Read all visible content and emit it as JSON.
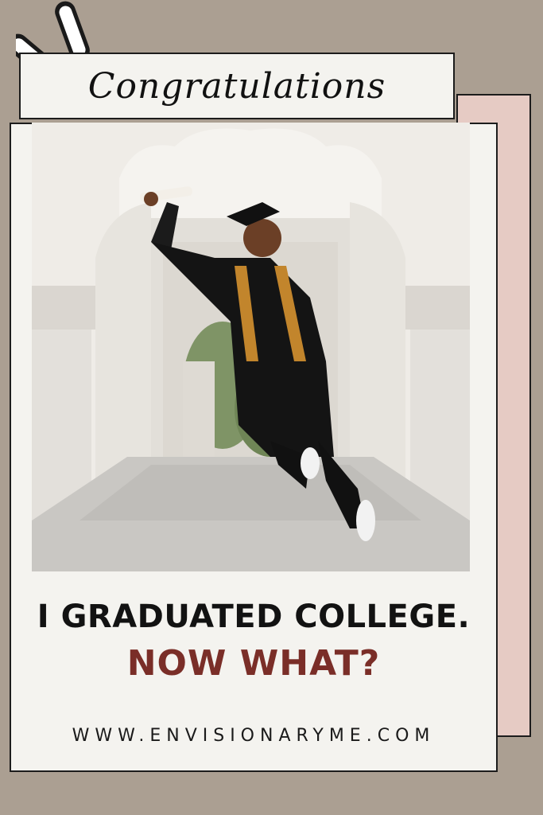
{
  "banner": {
    "text": "Congratulations"
  },
  "headline": {
    "line1": "I GRADUATED COLLEGE.",
    "line2": "NOW WHAT?"
  },
  "footer": {
    "url": "WWW.ENVISIONARYME.COM"
  },
  "colors": {
    "background": "#ab9f92",
    "card": "#f4f3ef",
    "accent_card": "#e6cbc4",
    "accent_text": "#7a2e28"
  },
  "photo": {
    "subject": "graduate-jumping-in-archway",
    "icon": "photo-icon"
  }
}
